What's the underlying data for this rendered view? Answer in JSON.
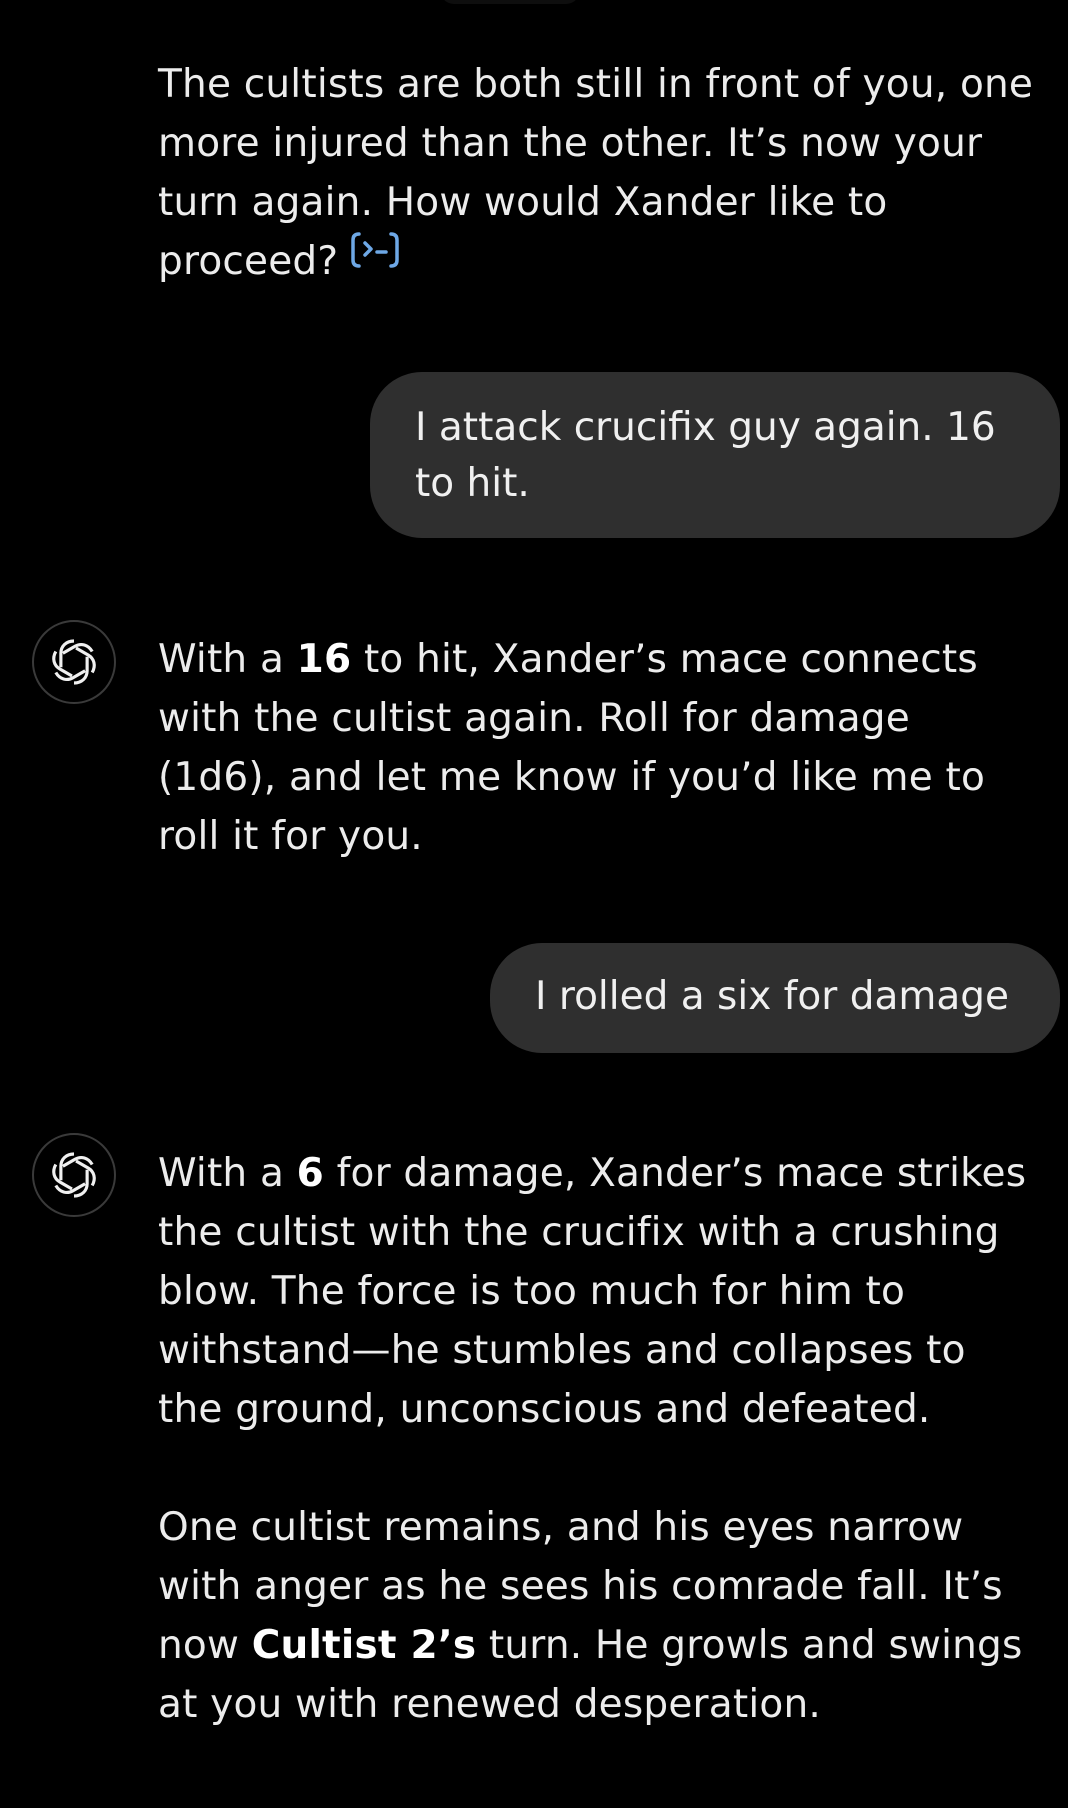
{
  "conversation": {
    "assistant_1": {
      "text": "The cultists are both still in front of you, one more injured than the other. It’s now your turn again. How would Xander like to proceed?",
      "trailing_icon": "code-interpreter-icon"
    },
    "user_1": {
      "text": "I attack crucifix guy again. 16 to hit."
    },
    "assistant_2": {
      "avatar_icon": "openai-logo-icon",
      "part1": "With a ",
      "bold1": "16",
      "part2": " to hit, Xander’s mace connects with the cultist again. Roll for damage (1d6), and let me know if you’d like me to roll it for you."
    },
    "user_2": {
      "text": "I rolled a six for damage"
    },
    "assistant_3": {
      "avatar_icon": "openai-logo-icon",
      "p1_part1": "With a ",
      "p1_bold": "6",
      "p1_part2": " for damage, Xander’s mace strikes the cultist with the crucifix with a crushing blow. The force is too much for him to withstand—he stumbles and collapses to the ground, unconscious and defeated.",
      "p2_part1": "One cultist remains, and his eyes narrow with anger as he sees his comrade fall. It’s now ",
      "p2_bold": "Cultist 2’s",
      "p2_part2": " turn. He growls and swings at you with renewed desperation."
    }
  },
  "colors": {
    "background": "#000000",
    "user_bubble": "#2f2f2f",
    "text": "#ececec",
    "icon_accent": "#6ea8e6"
  }
}
